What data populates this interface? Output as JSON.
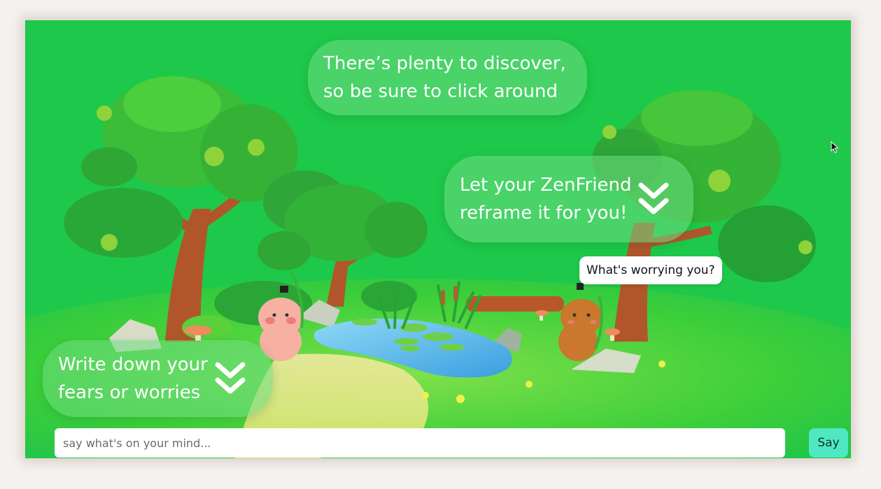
{
  "bubbles": {
    "discover": {
      "line1": "There’s plenty to discover,",
      "line2": "so be sure to click around"
    },
    "reframe": {
      "line1": "Let your ZenFriend",
      "line2": "reframe it for you!"
    },
    "write": {
      "line1": "Write down your",
      "line2": "fears or worries"
    }
  },
  "character_speech": "What's worrying you?",
  "input": {
    "placeholder": "say what's on your mind..."
  },
  "say_button": "Say",
  "icons": {
    "hint_chevron": "double-chevron-down-icon",
    "pointer": "mouse-cursor-icon"
  },
  "colors": {
    "background_green": "#1ec84a",
    "bubble_fill": "rgba(110,220,130,0.55)",
    "say_button": "#4fe8c2"
  }
}
